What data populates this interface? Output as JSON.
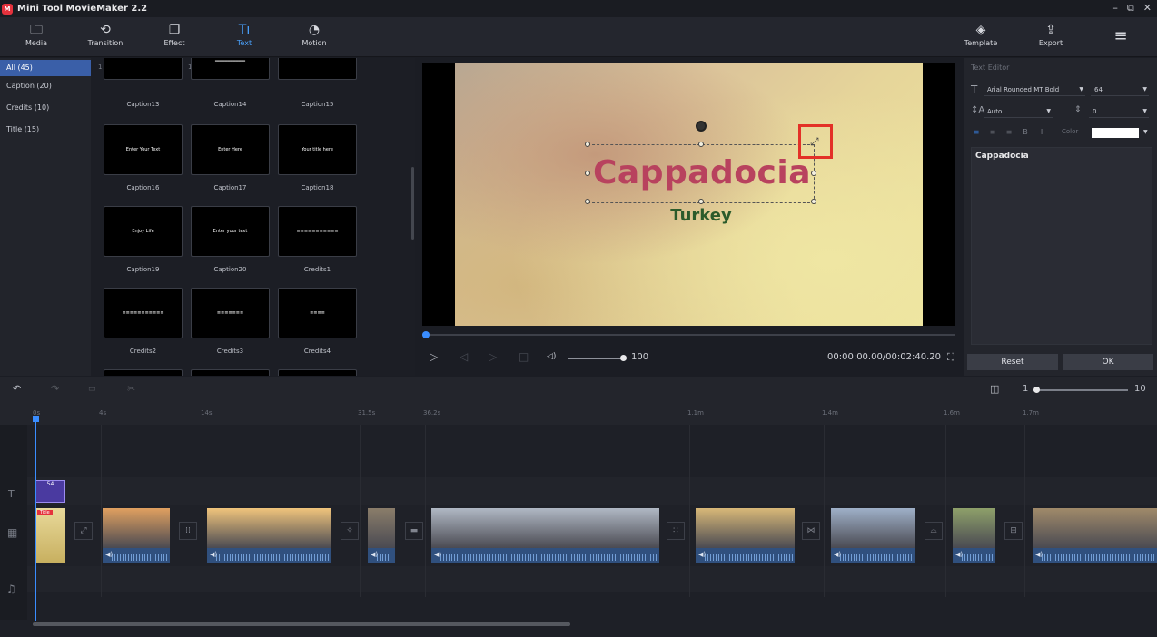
{
  "app": {
    "title": "Mini Tool MovieMaker 2.2",
    "logo_text": "M"
  },
  "window_controls": {
    "minimize": "–",
    "restore": "⧉",
    "close": "✕"
  },
  "toolbar": {
    "media": "Media",
    "transition": "Transition",
    "effect": "Effect",
    "text": "Text",
    "motion": "Motion",
    "template": "Template",
    "export": "Export",
    "menu_icon": "≡",
    "icons": {
      "media": "🗀",
      "transition": "⟲",
      "effect": "❐",
      "text": "T⃣",
      "motion": "◔",
      "template": "◈",
      "export": "⇪"
    }
  },
  "categories": [
    {
      "label": "All (45)"
    },
    {
      "label": "Caption (20)"
    },
    {
      "label": "Credits (10)"
    },
    {
      "label": "Title (15)"
    }
  ],
  "grid": {
    "zoom_min": "1",
    "zoom_max": "100",
    "items": [
      {
        "label": "Caption13",
        "preview": ""
      },
      {
        "label": "Caption14",
        "preview": "═══════════"
      },
      {
        "label": "Caption15",
        "preview": ""
      },
      {
        "label": "Caption16",
        "preview": "Enter Your Text"
      },
      {
        "label": "Caption17",
        "preview": "Enter Here"
      },
      {
        "label": "Caption18",
        "preview": "Your title here"
      },
      {
        "label": "Caption19",
        "preview": "Enjoy Life"
      },
      {
        "label": "Caption20",
        "preview": "Enter your text"
      },
      {
        "label": "Credits1",
        "preview": "≡≡≡≡≡≡≡≡≡≡≡"
      },
      {
        "label": "Credits2",
        "preview": "≡≡≡≡≡≡≡≡≡≡≡"
      },
      {
        "label": "Credits3",
        "preview": "≡≡≡≡≡≡≡"
      },
      {
        "label": "Credits4",
        "preview": "≡≡≡≡"
      }
    ]
  },
  "preview": {
    "main_text": "Cappadocia",
    "sub_text": "Turkey",
    "volume": "100",
    "timecode": "00:00:00.00/00:02:40.20",
    "controls": {
      "play": "▷",
      "prev": "◁",
      "next": "▷",
      "stop": "□",
      "volume_icon": "◁)",
      "fullscreen": "⛶"
    }
  },
  "editor": {
    "header": "Text Editor",
    "font": "Arial Rounded MT Bold",
    "size": "64",
    "spacing": "Auto",
    "line": "0",
    "color_label": "Color",
    "color_value": "#ffffff",
    "text": "Cappadocia",
    "reset": "Reset",
    "ok": "OK",
    "align": [
      "≡",
      "≡",
      "≡",
      "B",
      "I"
    ]
  },
  "timeline_toolbar": {
    "undo": "↶",
    "redo": "↷",
    "delete": "🗑",
    "cut": "✂",
    "zoom_value": "1",
    "zoom_max": "10",
    "fit_icon": "◫"
  },
  "ruler": [
    "0s",
    "4s",
    "14s",
    "31.5s",
    "36.2s",
    "1.1m",
    "1.4m",
    "1.6m",
    "1.7m"
  ],
  "tracks": {
    "text_icon": "T",
    "video_icon": "▦",
    "music_icon": "♫",
    "text_clip": "54",
    "title_clip": "Title"
  },
  "clip_colors": [
    "#c8b67a",
    "#e0a060",
    "#f0c47c",
    "#8a7d6a",
    "#b0b8c4",
    "#d8b878",
    "#9fb0c8",
    "#8ea06a",
    "#a08a6a"
  ]
}
